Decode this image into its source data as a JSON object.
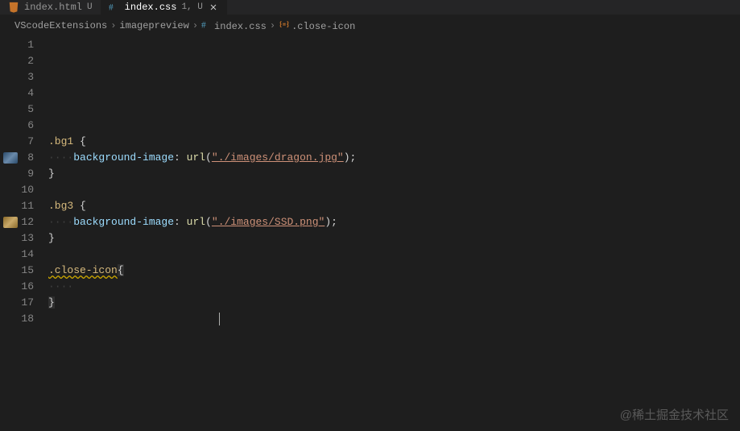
{
  "tabs": [
    {
      "icon": "html-icon",
      "label": "index.html",
      "badge": "U",
      "active": false,
      "close": false
    },
    {
      "icon": "css-icon",
      "label": "index.css",
      "badge": "1, U",
      "active": true,
      "close": true
    }
  ],
  "breadcrumbs": {
    "items": [
      {
        "label": "VScodeExtensions"
      },
      {
        "label": "imagepreview"
      },
      {
        "label": "index.css",
        "icon": "css-icon"
      },
      {
        "label": ".close-icon",
        "icon": "symbol-icon"
      }
    ],
    "sep": "›"
  },
  "lineNumbers": [
    "1",
    "2",
    "3",
    "4",
    "5",
    "6",
    "7",
    "8",
    "9",
    "10",
    "11",
    "12",
    "13",
    "14",
    "15",
    "16",
    "17",
    "18"
  ],
  "code": {
    "bg1_selector": ".bg1",
    "bg3_selector": ".bg3",
    "close_selector": ".close-icon",
    "brace_open": "{",
    "brace_close": "}",
    "semicolon": ";",
    "paren_open": "(",
    "paren_close": ")",
    "prop_bg_image": "background-image",
    "colon": ":",
    "func_url": "url",
    "str_dragon": "\"./images/dragon.jpg\"",
    "str_ssd": "\"./images/SSD.png\"",
    "indent": "····",
    "space": " "
  },
  "glyphPositions": {
    "img1": 143,
    "img2": 223
  },
  "watermark": "@稀土掘金技术社区"
}
